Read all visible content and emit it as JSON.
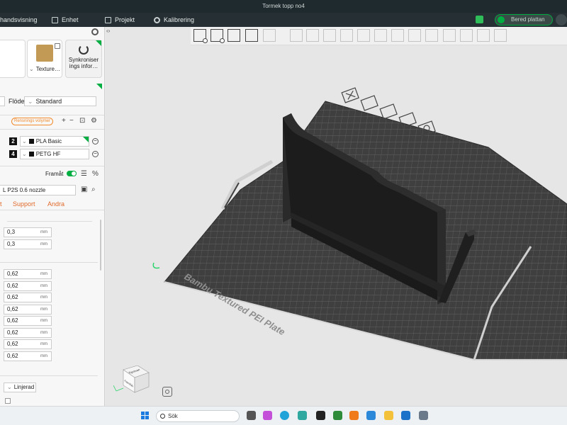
{
  "window": {
    "title": "Tormek topp no4"
  },
  "menu": {
    "items": [
      {
        "label": "handsvisning"
      },
      {
        "label": "Enhet"
      },
      {
        "label": "Projekt"
      },
      {
        "label": "Kalibrering"
      }
    ],
    "prepare_button": "Bered plattan"
  },
  "left_panel": {
    "plate_type": {
      "label": "Texture…"
    },
    "sync": {
      "label": "Synkroniser ings infor…"
    },
    "flow": {
      "label": "Flöde",
      "value": "Standard"
    },
    "filament": {
      "purge_badge": "Rensnings volymer",
      "add": "+",
      "remove": "−",
      "items": [
        {
          "index": "2",
          "name": "PLA Basic"
        },
        {
          "index": "4",
          "name": "PETG HF"
        }
      ]
    },
    "process": {
      "advanced_label": "Framåt",
      "advanced_on": true,
      "preset": "L P2S 0.6 nozzle"
    },
    "tabs": [
      {
        "label": "t"
      },
      {
        "label": "Support"
      },
      {
        "label": "Andra"
      }
    ],
    "params": [
      {
        "value": "0,3",
        "unit": "mm"
      },
      {
        "value": "0,3",
        "unit": "mm"
      },
      {
        "value": "0,62",
        "unit": "mm"
      },
      {
        "value": "0,62",
        "unit": "mm"
      },
      {
        "value": "0,62",
        "unit": "mm"
      },
      {
        "value": "0,62",
        "unit": "mm"
      },
      {
        "value": "0,62",
        "unit": "mm"
      },
      {
        "value": "0,62",
        "unit": "mm"
      },
      {
        "value": "0,62",
        "unit": "mm"
      },
      {
        "value": "0,62",
        "unit": "mm"
      }
    ],
    "wall_generator": "Linjerad"
  },
  "canvas": {
    "plate_label": "Bambu Textured PEI Plate",
    "view_cube": {
      "top": "Top/ovan",
      "front": "Framifrån"
    }
  },
  "taskbar": {
    "search_placeholder": "Sök"
  },
  "colors": {
    "accent": "#00ae42",
    "orange": "#e06a2b",
    "plate": "#3f3f3f",
    "grid": "#6b6b6b",
    "model": "#1c1c1c"
  }
}
